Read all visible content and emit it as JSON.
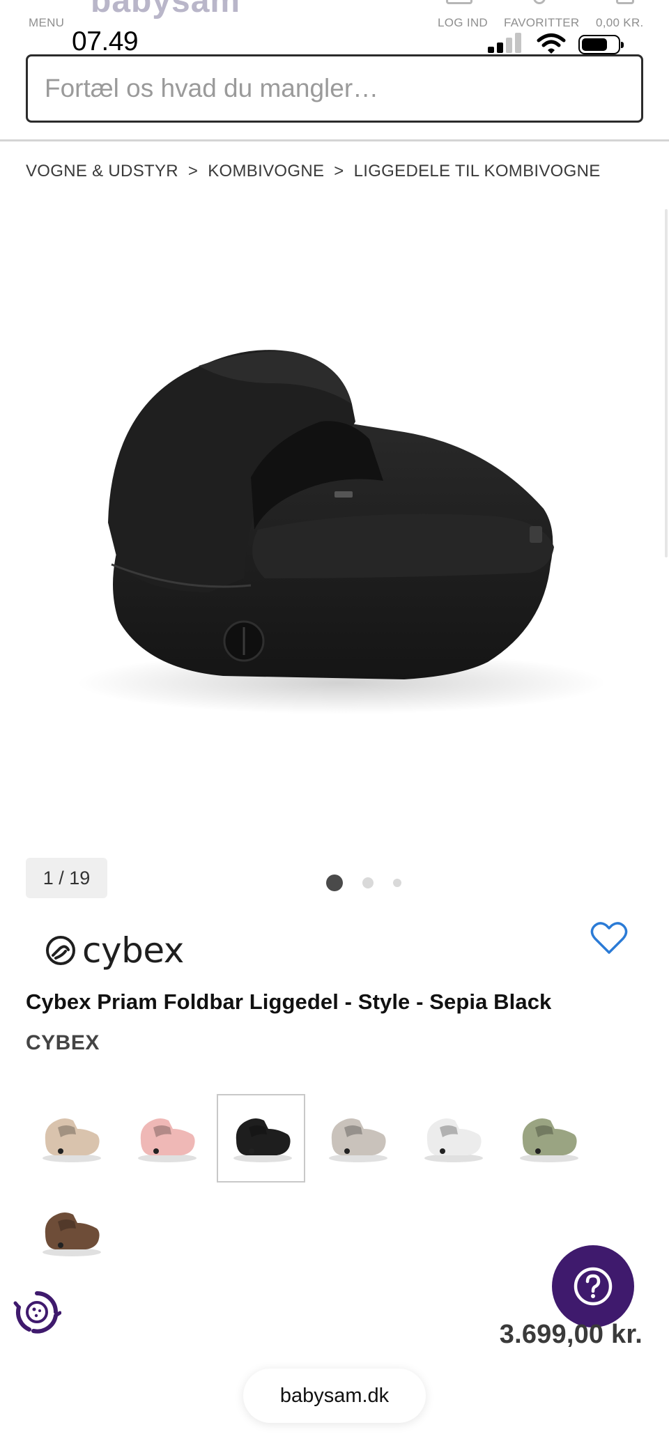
{
  "header": {
    "logo_partial": "babysam",
    "nav": {
      "menu_label": "MENU",
      "login_label": "LOG IND",
      "favorites_label": "FAVORITTER",
      "cart_label": "0,00 KR."
    }
  },
  "status_bar": {
    "time": "07.49",
    "icons": [
      "signal-icon",
      "wifi-icon",
      "battery-icon"
    ]
  },
  "search": {
    "placeholder": "Fortæl os hvad du mangler…"
  },
  "breadcrumb": {
    "items": [
      "VOGNE & UDSTYR",
      "KOMBIVOGNE",
      "LIGGEDELE TIL KOMBIVOGNE"
    ],
    "separator": ">"
  },
  "gallery": {
    "counter": "1 / 19",
    "current_index": 1,
    "total": 19
  },
  "product": {
    "brand_logo_text": "cybex",
    "title": "Cybex Priam Foldbar Liggedel - Style - Sepia Black",
    "brand": "CYBEX",
    "price": "3.699,00 kr.",
    "favorited": false
  },
  "swatches": [
    {
      "color": "#d9c3ad",
      "selected": false
    },
    {
      "color": "#efb8b6",
      "selected": false
    },
    {
      "color": "#1e1e1e",
      "selected": true
    },
    {
      "color": "#c9c2bb",
      "selected": false
    },
    {
      "color": "#ececec",
      "selected": false
    },
    {
      "color": "#9aa482",
      "selected": false
    },
    {
      "color": "#6e4d38",
      "selected": false
    }
  ],
  "footer": {
    "url": "babysam.dk"
  },
  "colors": {
    "accent_purple": "#3f1a6d",
    "heart_blue": "#2b7bd6",
    "price_gray": "#3a3a3a"
  }
}
